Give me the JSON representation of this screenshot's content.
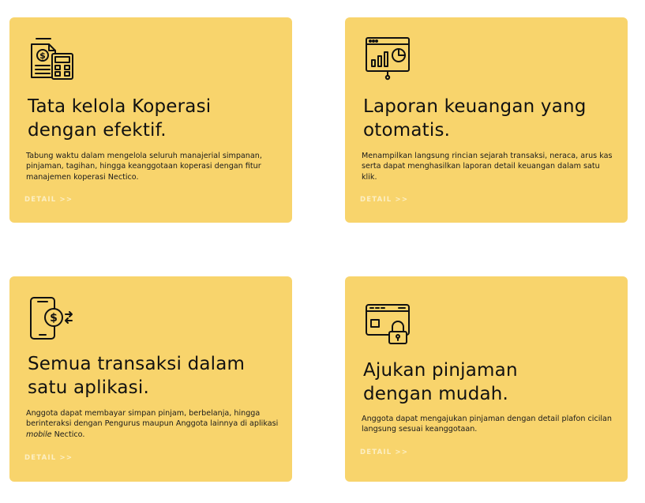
{
  "cards": [
    {
      "icon": "finance-calculator-icon",
      "title_line1": "Tata kelola Koperasi",
      "title_line2": "dengan efektif.",
      "description": "Tabung waktu dalam mengelola seluruh manajerial simpanan, pinjaman, tagihan, hingga keanggotaan koperasi dengan fitur manajemen koperasi Nectico.",
      "detail_label": "DETAIL >>"
    },
    {
      "icon": "report-chart-icon",
      "title_line1": "Laporan keuangan yang",
      "title_line2": "otomatis.",
      "description": "Menampilkan langsung rincian sejarah transaksi, neraca, arus kas serta dapat menghasilkan laporan detail keuangan dalam satu klik.",
      "detail_label": "DETAIL >>"
    },
    {
      "icon": "mobile-transaction-icon",
      "title_line1": "Semua transaksi dalam",
      "title_line2": "satu aplikasi.",
      "description_before": "Anggota dapat membayar simpan pinjam, berbelanja, hingga berinteraksi dengan Pengurus maupun Anggota lainnya di aplikasi ",
      "description_em": "mobile",
      "description_after": " Nectico.",
      "detail_label": "DETAIL >>"
    },
    {
      "icon": "secure-card-icon",
      "title_line1": "Ajukan pinjaman",
      "title_line2": "dengan mudah.",
      "description": "Anggota dapat mengajukan pinjaman dengan detail plafon cicilan langsung sesuai keanggotaan.",
      "detail_label": "DETAIL >>"
    }
  ],
  "colors": {
    "card_background": "#F8D46C",
    "text": "#111111",
    "detail_link": "#fcefc4"
  }
}
